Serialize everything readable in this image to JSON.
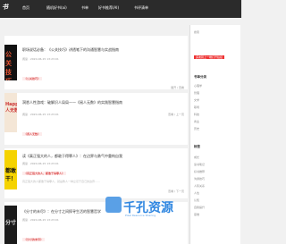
{
  "header": {
    "logo": "书",
    "nav": [
      "首页",
      "随机好书(ai)",
      "书单",
      "好书推荐(AI)",
      "书评清单"
    ]
  },
  "posts": [
    {
      "cover_text": "公关技巧",
      "title": "职场说话必备：《公关技巧》讲透笔下的沟通智慧与实战指南",
      "meta": "阅读 · 2020-06-15 13:23:01",
      "tag": "《公关技巧》",
      "desc": "",
      "more": "展开 / 查看"
    },
    {
      "cover_text": "Happen 人无数",
      "title": "洞悉人性游戏：破解识人局局——《阅人无数》的实践智慧指南",
      "meta": "阅读 · 2020-06-15 13:23:01",
      "tag": "《阅人无数》",
      "desc": "",
      "more": "查看 / 上一页"
    },
    {
      "cover_text": "都敢干！",
      "title": "读《真正强大的人，都敢于得罪人》：在边界与勇气中重构自我",
      "meta": "阅读 · 2020-06-15 13:23:01",
      "tag": "《真正强大的人，都敢于得罪人》",
      "desc": "真正强大的人都敢于得罪人，就是教人一种立足于自己的边界……",
      "more": "查看 / 下一页"
    },
    {
      "cover_text": "分寸",
      "title": "《分寸的未尽》：在分寸之间探寻生活的智慧哲学",
      "meta": "阅读 · 2020-06-15 13:23:01",
      "tag": "《分寸的未尽》",
      "desc": "",
      "more": ""
    }
  ],
  "sidebar": {
    "search_hint": "搜索",
    "badge": "多类别上一端打开链接",
    "section1": "书单分类",
    "items": [
      "心理学",
      "管理",
      "文学",
      "职场",
      "科技",
      "商业",
      "历史"
    ],
    "section2": "标签",
    "tags": [
      "成长",
      "读书笔记",
      "好书推荐",
      "沟通技巧",
      "人际关系",
      "人性",
      "认知",
      "自我提升",
      "思维"
    ]
  },
  "watermark": {
    "main": "千孔资源",
    "sub": "Pixel Resource Sharing"
  }
}
